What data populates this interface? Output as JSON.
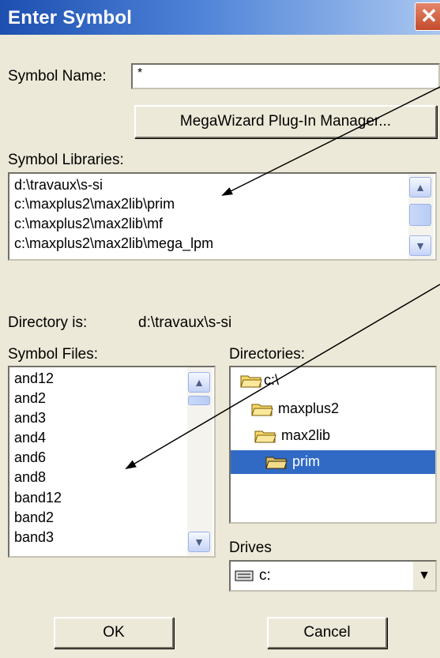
{
  "window": {
    "title": "Enter Symbol",
    "close_glyph": "✕"
  },
  "symbol_name": {
    "label": "Symbol Name:",
    "value": "*"
  },
  "megawizard_button": "MegaWizard Plug-In Manager...",
  "symbol_libraries": {
    "label": "Symbol Libraries:",
    "items": [
      "d:\\travaux\\s-si",
      "c:\\maxplus2\\max2lib\\prim",
      "c:\\maxplus2\\max2lib\\mf",
      "c:\\maxplus2\\max2lib\\mega_lpm"
    ]
  },
  "directory_is": {
    "label": "Directory is:",
    "value": "d:\\travaux\\s-si"
  },
  "symbol_files": {
    "label": "Symbol Files:",
    "items": [
      "and12",
      "and2",
      "and3",
      "and4",
      "and6",
      "and8",
      "band12",
      "band2",
      "band3"
    ]
  },
  "directories": {
    "label": "Directories:",
    "items": [
      "c:\\",
      "maxplus2",
      "max2lib",
      "prim"
    ],
    "selected": "prim"
  },
  "drives": {
    "label": "Drives",
    "value": "c:"
  },
  "buttons": {
    "ok": "OK",
    "cancel": "Cancel"
  },
  "colors": {
    "titlebar": "#1c4fb0",
    "selection": "#316ac5",
    "dialog_bg": "#ece9d8",
    "folder": "#f5d86b"
  }
}
